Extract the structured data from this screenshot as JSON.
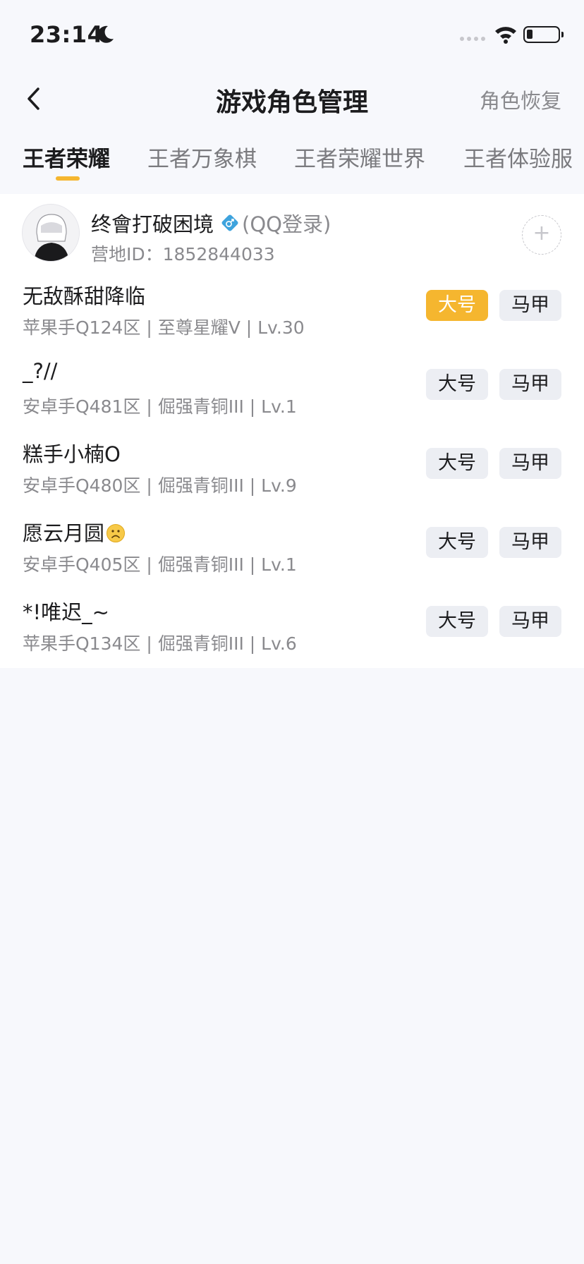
{
  "status_bar": {
    "time": "23:14"
  },
  "nav": {
    "title": "游戏角色管理",
    "action": "角色恢复"
  },
  "tabs": [
    {
      "label": "王者荣耀",
      "active": true
    },
    {
      "label": "王者万象棋",
      "active": false
    },
    {
      "label": "王者荣耀世界",
      "active": false
    },
    {
      "label": "王者体验服",
      "active": false
    }
  ],
  "colors": {
    "accent": "#f5b62f",
    "gender": "#3ea3dd"
  },
  "account": {
    "name": "终會打破困境",
    "gender_icon": "male-icon",
    "login_type": "(QQ登录)",
    "camp_id": "营地ID：1852844033"
  },
  "buttons": {
    "main_label": "大号",
    "alt_label": "马甲"
  },
  "roles": [
    {
      "name": "无敌酥甜降临",
      "detail": "苹果手Q124区 | 至尊星耀V | Lv.30",
      "main_selected": true
    },
    {
      "name": "_?//",
      "detail": "安卓手Q481区 | 倔强青铜III | Lv.1",
      "main_selected": false
    },
    {
      "name": "糕手小楠O",
      "detail": "安卓手Q480区 | 倔强青铜III | Lv.9",
      "main_selected": false
    },
    {
      "name": "愿云月圆",
      "name_icon": "sad-face-icon",
      "detail": "安卓手Q405区 | 倔强青铜III | Lv.1",
      "main_selected": false
    },
    {
      "name": "*!唯迟_~",
      "detail": "苹果手Q134区 | 倔强青铜III | Lv.6",
      "main_selected": false
    }
  ]
}
